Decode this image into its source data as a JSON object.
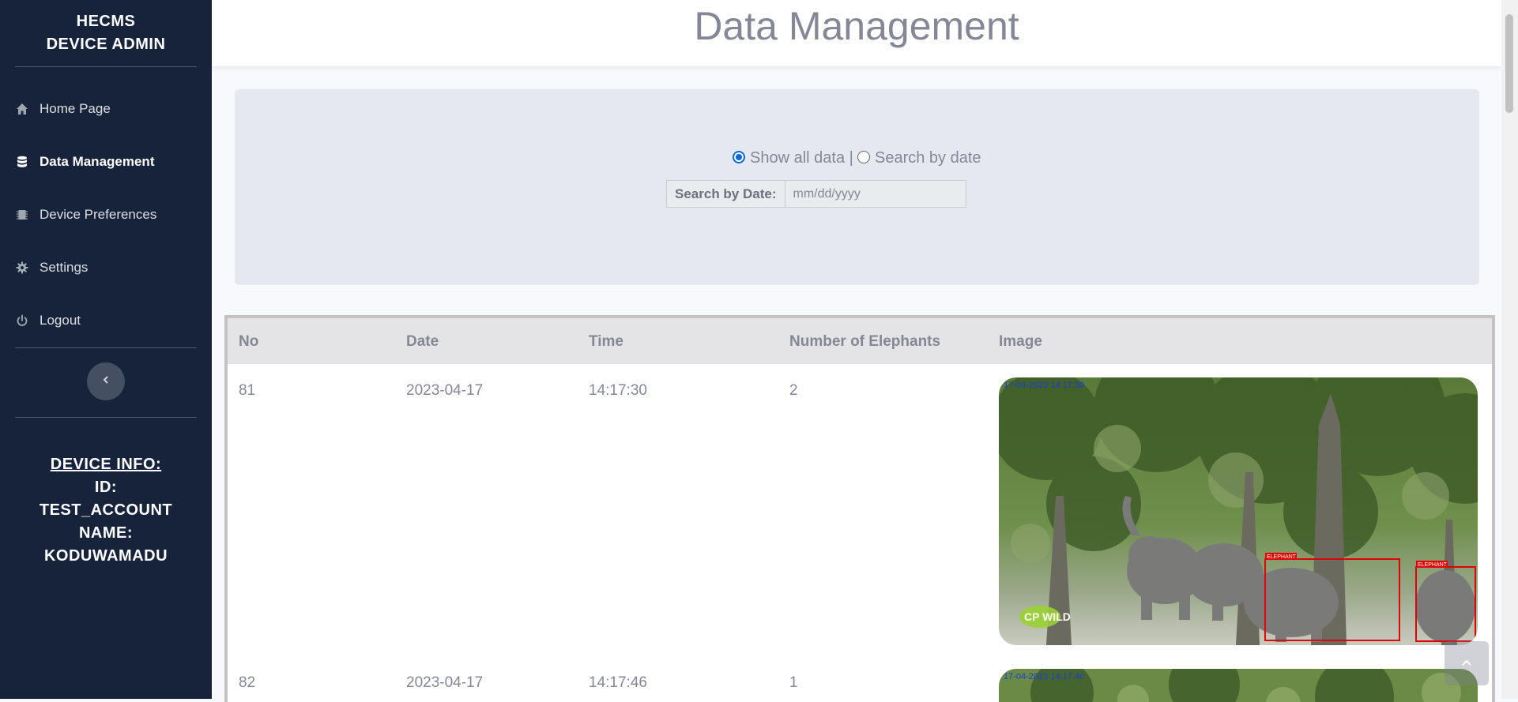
{
  "sidebar": {
    "brand_line1": "HECMS",
    "brand_line2": "DEVICE ADMIN",
    "items": [
      {
        "label": "Home Page",
        "icon": "home-icon"
      },
      {
        "label": "Data Management",
        "icon": "database-icon",
        "active": true
      },
      {
        "label": "Device Preferences",
        "icon": "microchip-icon"
      },
      {
        "label": "Settings",
        "icon": "gear-icon"
      },
      {
        "label": "Logout",
        "icon": "power-icon"
      }
    ],
    "toggle_icon": "chevron-left-icon",
    "device_info": {
      "heading": "DEVICE INFO:",
      "id_label": "ID:",
      "id_value": "TEST_ACCOUNT",
      "name_label": "NAME:",
      "name_value": "KODUWAMADU"
    }
  },
  "header": {
    "title": "Data Management"
  },
  "filter": {
    "option_all": "Show all data |",
    "option_date": "Search by date",
    "selected": "all",
    "date_label": "Search by Date:",
    "date_placeholder": "mm/dd/yyyy"
  },
  "table": {
    "columns": [
      "No",
      "Date",
      "Time",
      "Number of Elephants",
      "Image"
    ],
    "rows": [
      {
        "no": "81",
        "date": "2023-04-17",
        "time": "14:17:30",
        "count": "2",
        "image_timestamp": "17-04-2023 14:17:30",
        "detection_label": "ELEPHANT",
        "watermark": "CP WILD"
      },
      {
        "no": "82",
        "date": "2023-04-17",
        "time": "14:17:46",
        "count": "1",
        "image_timestamp": "17-04-2023 14:17:46"
      }
    ]
  },
  "colors": {
    "sidebar_bg": "#16233b",
    "page_bg": "#f8f9fc",
    "text_muted": "#858796",
    "radio_accent": "#0b67d8",
    "detection_box": "#e00000"
  }
}
